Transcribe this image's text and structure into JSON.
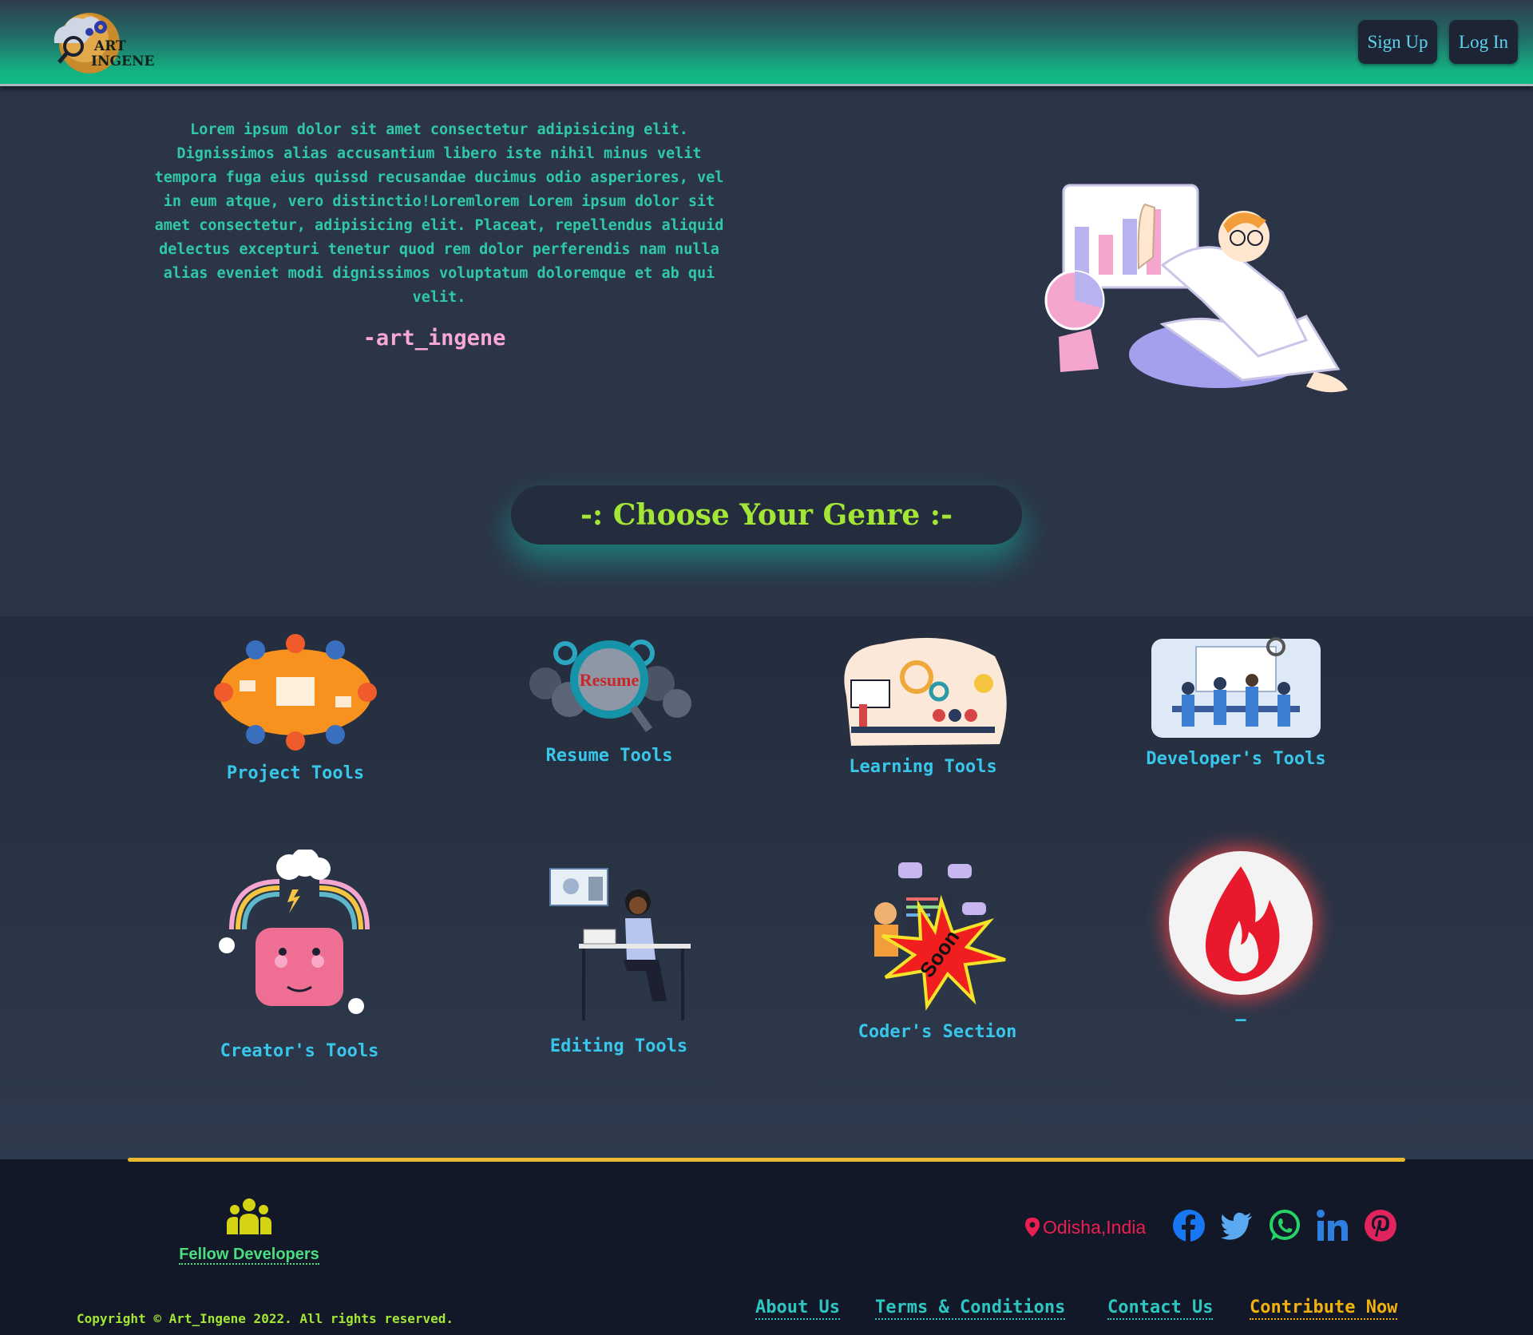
{
  "header": {
    "logo_line1": "ART",
    "logo_line2": "INGENE",
    "signup_label": "Sign Up",
    "login_label": "Log In"
  },
  "hero": {
    "quote": "Lorem ipsum dolor sit amet consectetur adipisicing elit. Dignissimos alias accusantium libero iste nihil minus velit tempora fuga eius quissd recusandae ducimus odio asperiores, vel in eum atque, vero distinctio!Loremlorem Lorem ipsum dolor sit amet consectetur, adipisicing elit. Placeat, repellendus aliquid delectus excepturi tenetur quod rem dolor perferendis nam nulla alias eveniet modi dignissimos voluptatum doloremque et ab qui velit.",
    "signature": "-art_ingene"
  },
  "genre_heading": "-: Choose Your Genre :-",
  "tools": [
    {
      "label": "Project Tools",
      "icon": "team-meeting-icon"
    },
    {
      "label": "Resume Tools",
      "icon": "resume-magnifier-icon"
    },
    {
      "label": "Learning Tools",
      "icon": "learning-illustration-icon"
    },
    {
      "label": "Developer's Tools",
      "icon": "developer-team-icon"
    },
    {
      "label": "Creator's Tools",
      "icon": "creator-head-icon"
    },
    {
      "label": "Editing Tools",
      "icon": "editing-desk-icon"
    },
    {
      "label": "Coder's Section",
      "icon": "coder-soon-icon",
      "badge": "Soon"
    },
    {
      "label": "—",
      "icon": "fire-icon"
    }
  ],
  "footer": {
    "fellow_label": "Fellow Developers",
    "location": "Odisha,India",
    "socials": [
      "facebook",
      "twitter",
      "whatsapp",
      "linkedin",
      "pinterest"
    ],
    "copyright": "Copyright © Art_Ingene 2022. All rights reserved.",
    "links": {
      "about": "About Us",
      "terms": "Terms & Conditions",
      "contact": "Contact Us",
      "contribute": "Contribute Now"
    }
  },
  "colors": {
    "accent_teal": "#2dc6c0",
    "accent_lime": "#a3e635",
    "accent_gold": "#f2b10c",
    "location_red": "#ef1e52"
  }
}
